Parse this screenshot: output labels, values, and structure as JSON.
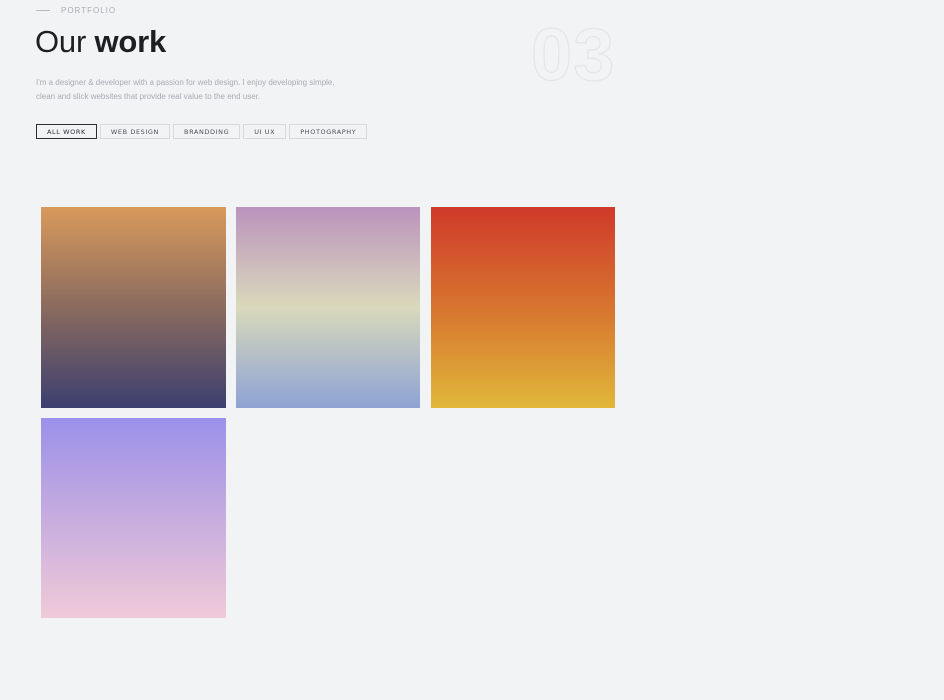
{
  "header": {
    "eyebrow": "PORTFOLIO",
    "title_light": "Our",
    "title_bold": "work",
    "section_number": "03",
    "description": "I'm a designer & developer with a passion for web design. I enjoy developing simple, clean and slick websites that provide real value to the end user."
  },
  "filters": [
    {
      "label": "ALL WORK",
      "active": true
    },
    {
      "label": "WEB DESIGN",
      "active": false
    },
    {
      "label": "BRANDDING",
      "active": false
    },
    {
      "label": "UI UX",
      "active": false
    },
    {
      "label": "PHOTOGRAPHY",
      "active": false
    }
  ],
  "portfolio": {
    "items": [
      {
        "gradient": [
          "#d99a5c",
          "#8a6b5e",
          "#3d3f70"
        ]
      },
      {
        "gradient": [
          "#bb93bd",
          "#d9d9bb",
          "#8da3d4"
        ]
      },
      {
        "gradient": [
          "#cf3a2a",
          "#d7742f",
          "#e1b73a"
        ]
      },
      {
        "gradient": [
          "#9b90ea",
          "#c7addf",
          "#f0cad8"
        ]
      }
    ]
  }
}
